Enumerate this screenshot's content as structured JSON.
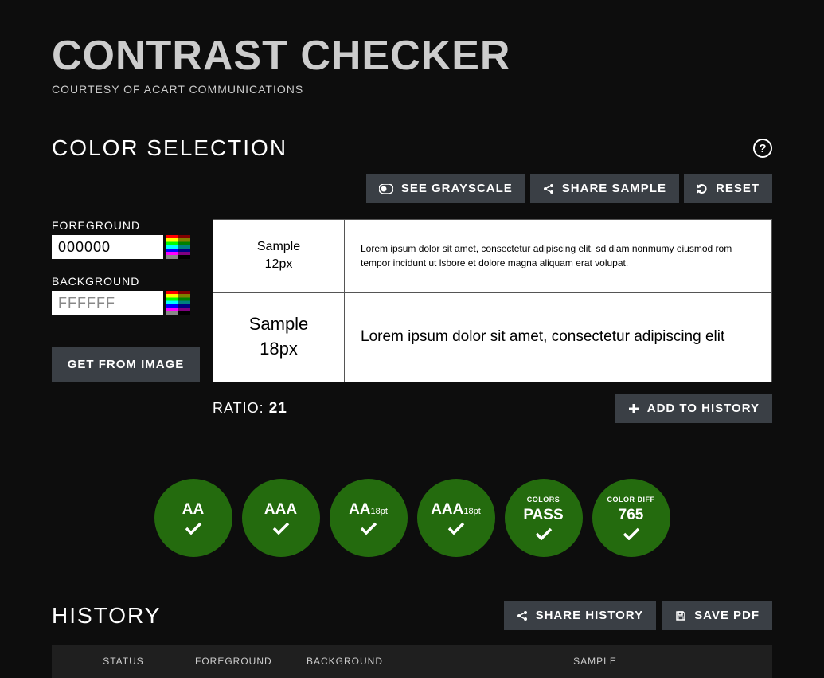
{
  "header": {
    "title": "CONTRAST CHECKER",
    "subtitle": "COURTESY OF ACART COMMUNICATIONS"
  },
  "colorSelection": {
    "title": "COLOR SELECTION",
    "helpLabel": "?"
  },
  "toolbar": {
    "grayscale": "SEE GRAYSCALE",
    "share": "SHARE SAMPLE",
    "reset": "RESET"
  },
  "inputs": {
    "foregroundLabel": "FOREGROUND",
    "foregroundValue": "000000",
    "backgroundLabel": "BACKGROUND",
    "backgroundValue": "FFFFFF",
    "getFromImage": "GET FROM IMAGE"
  },
  "samples": {
    "label12": "Sample",
    "size12": "12px",
    "text12": "Lorem ipsum dolor sit amet, consectetur adipiscing elit, sd diam nonmumy eiusmod rom tempor incidunt ut lsbore et dolore magna aliquam erat volupat.",
    "label18": "Sample",
    "size18": "18px",
    "text18": "Lorem ipsum dolor sit amet, consectetur adipiscing elit"
  },
  "ratio": {
    "label": "RATIO:",
    "value": "21"
  },
  "addHistory": "ADD TO HISTORY",
  "results": {
    "aa": "AA",
    "aaa": "AAA",
    "aa18": "AA",
    "aa18suffix": "18pt",
    "aaa18": "AAA",
    "aaa18suffix": "18pt",
    "colorsTop": "COLORS",
    "colorsLabel": "PASS",
    "diffTop": "COLOR DIFF",
    "diffLabel": "765"
  },
  "history": {
    "title": "HISTORY",
    "share": "SHARE HISTORY",
    "save": "SAVE PDF",
    "columns": {
      "status": "STATUS",
      "foreground": "FOREGROUND",
      "background": "BACKGROUND",
      "sample": "SAMPLE"
    }
  }
}
